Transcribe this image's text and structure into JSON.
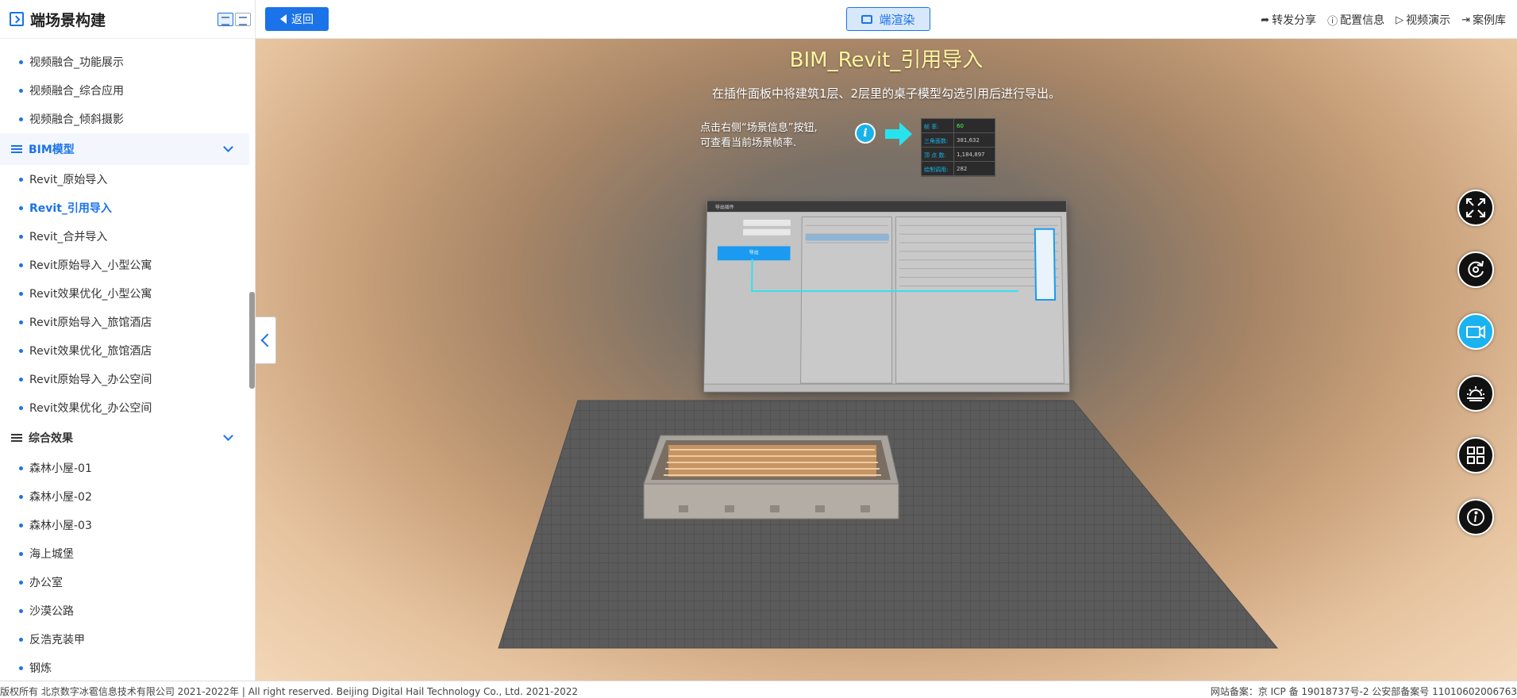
{
  "sidebar": {
    "title": "端场景构建",
    "items": [
      {
        "type": "item",
        "label": "视频融合_功能展示"
      },
      {
        "type": "item",
        "label": "视频融合_综合应用"
      },
      {
        "type": "item",
        "label": "视频融合_倾斜摄影"
      },
      {
        "type": "group",
        "label": "BIM模型",
        "open": true
      },
      {
        "type": "item",
        "label": "Revit_原始导入"
      },
      {
        "type": "item",
        "label": "Revit_引用导入",
        "active": true
      },
      {
        "type": "item",
        "label": "Revit_合并导入"
      },
      {
        "type": "item",
        "label": "Revit原始导入_小型公寓"
      },
      {
        "type": "item",
        "label": "Revit效果优化_小型公寓"
      },
      {
        "type": "item",
        "label": "Revit原始导入_旅馆酒店"
      },
      {
        "type": "item",
        "label": "Revit效果优化_旅馆酒店"
      },
      {
        "type": "item",
        "label": "Revit原始导入_办公空间"
      },
      {
        "type": "item",
        "label": "Revit效果优化_办公空间"
      },
      {
        "type": "group",
        "label": "综合效果",
        "open": false
      },
      {
        "type": "item",
        "label": "森林小屋-01"
      },
      {
        "type": "item",
        "label": "森林小屋-02"
      },
      {
        "type": "item",
        "label": "森林小屋-03"
      },
      {
        "type": "item",
        "label": "海上城堡"
      },
      {
        "type": "item",
        "label": "办公室"
      },
      {
        "type": "item",
        "label": "沙漠公路"
      },
      {
        "type": "item",
        "label": "反浩克装甲"
      },
      {
        "type": "item",
        "label": "钢炼"
      }
    ]
  },
  "topbar": {
    "back_label": "返回",
    "render_label": "端渲染",
    "actions": [
      {
        "icon": "share-icon",
        "glyph": "➦",
        "label": "转发分享"
      },
      {
        "icon": "info-icon",
        "glyph": "ⓘ",
        "label": "配置信息"
      },
      {
        "icon": "play-icon",
        "glyph": "▷",
        "label": "视频演示"
      },
      {
        "icon": "library-icon",
        "glyph": "⇥",
        "label": "案例库"
      }
    ]
  },
  "viewport": {
    "title": "BIM_Revit_引用导入",
    "subtitle": "在插件面板中将建筑1层、2层里的桌子模型勾选引用后进行导出。",
    "hint_line1": "点击右侧“场景信息”按钮,",
    "hint_line2": "可查看当前场景帧率.",
    "stats": [
      {
        "k": "帧 率:",
        "v": "60",
        "green": true
      },
      {
        "k": "三角面数:",
        "v": "381,632"
      },
      {
        "k": "顶 点 数:",
        "v": "1,184,897"
      },
      {
        "k": "绘制调用:",
        "v": "282"
      }
    ],
    "dialog": {
      "title": "导出插件",
      "export_label": "导出"
    }
  },
  "tools": [
    {
      "name": "fullscreen-button",
      "icon": "fullscreen-icon"
    },
    {
      "name": "reset-view-button",
      "icon": "refresh-icon"
    },
    {
      "name": "video-button",
      "icon": "camera-icon",
      "active": true
    },
    {
      "name": "weather-button",
      "icon": "weather-icon"
    },
    {
      "name": "scene-list-button",
      "icon": "grid-icon"
    },
    {
      "name": "scene-info-button",
      "icon": "info-icon"
    }
  ],
  "footer": {
    "left": "版权所有 北京数字冰雹信息技术有限公司 2021-2022年 | All right reserved. Beijing Digital Hail Technology Co., Ltd. 2021-2022",
    "right": "网站备案：京 ICP 备 19018737号-2 公安部备案号 11010602006763"
  },
  "colors": {
    "accent": "#1a73e8",
    "title_yellow": "#fff6a0",
    "cyan": "#1ab3f0"
  }
}
